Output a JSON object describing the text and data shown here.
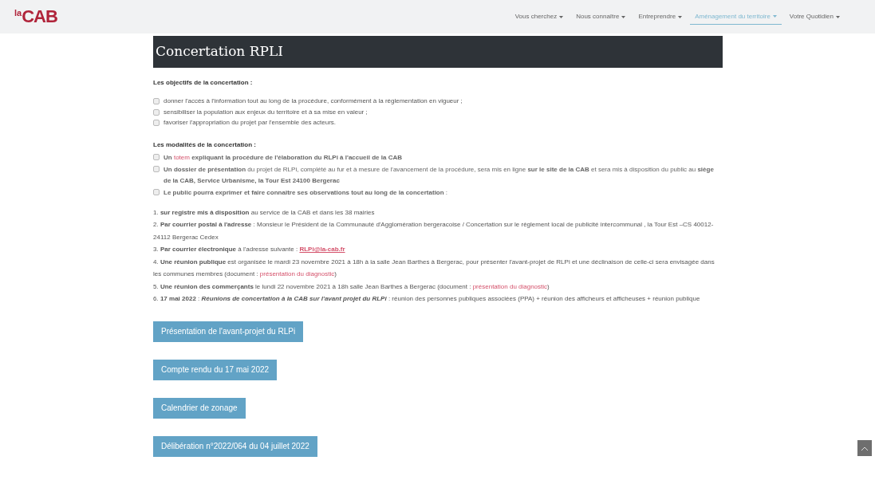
{
  "header": {
    "logo": {
      "prefix": "la",
      "name": "CAB"
    },
    "nav": [
      {
        "label": "Vous cherchez",
        "selected": false
      },
      {
        "label": "Nous connaître",
        "selected": false
      },
      {
        "label": "Entreprendre",
        "selected": false
      },
      {
        "label": "Aménagement du territoire",
        "selected": true
      },
      {
        "label": "Votre Quotidien",
        "selected": false
      }
    ]
  },
  "title": "Concertation RPLI",
  "objectives": {
    "heading": "Les objectifs de la concertation :",
    "items": [
      "donner l'accès à l'information tout au long de la procédure, conformément à la réglementation en vigueur ;",
      "sensibiliser la population aux enjeux du territoire et à sa mise en valeur ;",
      "favoriser l'appropriation du projet par l'ensemble des acteurs."
    ]
  },
  "modalities": {
    "heading": "Les modalités de la concertation :",
    "items": [
      [
        {
          "kind": "text",
          "text": "**Un** "
        },
        {
          "kind": "link",
          "text": "totem"
        },
        {
          "kind": "text",
          "text": " **expliquant la procédure de l'élaboration du RLPi à l'accueil de la CAB**"
        }
      ],
      [
        {
          "kind": "text",
          "text": "**Un dossier de présentation** du projet de RLPi, complété au fur et à mesure de l'avancement de la procédure, sera mis en ligne **sur le site de la CAB** et sera mis à disposition du public au **siège de la CAB, Service Urbanisme,  la Tour Est  24100 Bergerac**"
        }
      ],
      [
        {
          "kind": "text",
          "text": "**Le public pourra exprimer et faire connaître ses observations tout au long de la concertation** :"
        }
      ]
    ]
  },
  "ways": [
    [
      {
        "kind": "text",
        "text": "1. **sur registre mis à disposition** au service de la CAB et dans les 38 mairies"
      }
    ],
    [
      {
        "kind": "text",
        "text": "2. **Par courrier postal à l'adresse** : Monsieur le Président de la Communauté d'Agglomération bergeracoise / Concertation sur le règlement local de publicité intercommunal , la Tour Est –CS 40012-24112 Bergerac Cedex"
      }
    ],
    [
      {
        "kind": "text",
        "text": "3. **Par courrier électronique** à l'adresse suivante : "
      },
      {
        "kind": "email",
        "text": "RLPi@la-cab.fr"
      }
    ],
    [
      {
        "kind": "text",
        "text": "4. **Une réunion publique** est organisée le mardi 23 novembre 2021 à 18h à la salle Jean Barthes à Bergerac, pour présenter l'avant-projet de RLPi et une déclinaison de celle-ci sera envisagée dans les communes membres (document : "
      },
      {
        "kind": "link",
        "text": "présentation du diagnostic"
      },
      {
        "kind": "text",
        "text": ")"
      }
    ],
    [
      {
        "kind": "text",
        "text": "5. **Une réunion des commerçants** le lundi 22 novembre 2021 à 18h salle Jean Barthes à Bergerac (document : "
      },
      {
        "kind": "link",
        "text": "présentation du diagnostic"
      },
      {
        "kind": "text",
        "text": ")"
      }
    ],
    [
      {
        "kind": "text",
        "text": "6. **17 mai 2022** : "
      },
      {
        "kind": "bold-italic",
        "text": "Réunions de concertation à la CAB sur l'avant projet du RLPi"
      },
      {
        "kind": "text",
        "text": " : réunion des personnes publiques associées (PPA) + réunion des afficheurs et afficheuses + réunion publique"
      }
    ]
  ],
  "buttons": [
    "Présentation de l'avant-projet du RLPi",
    "Compte rendu du 17 mai 2022",
    "Calendrier de zonage",
    "Délibération n°2022/064 du 04 juillet 2022"
  ]
}
